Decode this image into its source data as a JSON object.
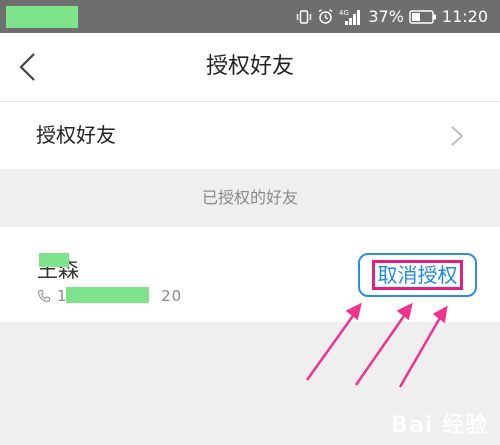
{
  "status_bar": {
    "network_label": "4G",
    "battery_pct": "37%",
    "time": "11:20",
    "icons": [
      "vibrate-icon",
      "alarm-icon",
      "signal-icon",
      "battery-icon"
    ]
  },
  "nav": {
    "title": "授权好友",
    "back_icon": "chevron-left-icon"
  },
  "menu_row": {
    "label": "授权好友",
    "chevron_icon": "chevron-right-icon"
  },
  "section": {
    "header": "已授权的好友"
  },
  "friend": {
    "name": "王森",
    "phone": "15",
    "phone_suffix": "20",
    "phone_icon": "phone-icon"
  },
  "revoke": {
    "label": "取消授权"
  },
  "watermark": {
    "text": "Bai 经验"
  },
  "colors": {
    "accent": "#1e88e5",
    "highlight": "#e1207f",
    "redaction": "#7ee38a"
  }
}
